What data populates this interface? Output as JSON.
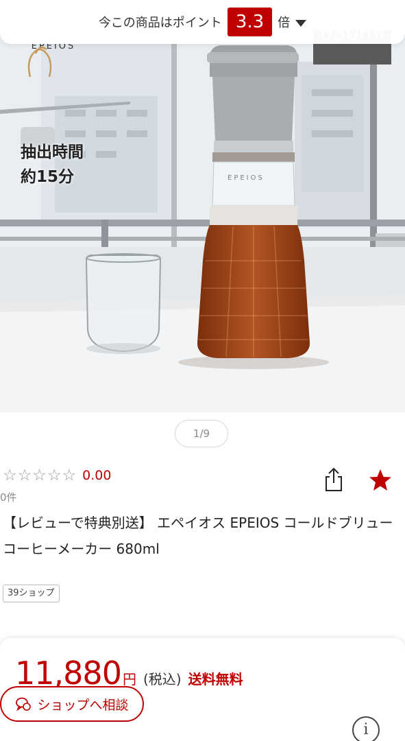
{
  "points_banner": {
    "prefix": "今この商品はポイント",
    "rate": "3.3",
    "unit": "倍",
    "caret_icon": "caret-down-icon"
  },
  "hero": {
    "brand": "EPEIOS",
    "brew_time_line1": "抽出時間",
    "brew_time_line2": "約15分",
    "capacity": "680ml",
    "bottle_label": "EPEIOS"
  },
  "pager": {
    "label": "1/9"
  },
  "rating": {
    "stars": 0,
    "max_stars": 5,
    "score": "0.00",
    "count": "0件"
  },
  "actions": {
    "share_icon": "share-icon",
    "favorite_icon": "star-icon"
  },
  "product": {
    "title": "【レビューで特典別送】 エペイオス EPEIOS コールドブリューコーヒーメーカー 680ml",
    "shop_tag": "39ショップ"
  },
  "price": {
    "amount": "11,880",
    "yen": "円",
    "tax": "(税込)",
    "shipping": "送料無料"
  },
  "consult": {
    "label": "ショップへ相談",
    "icon": "chat-icon"
  },
  "info": {
    "label": "i"
  },
  "colors": {
    "accent": "#bf0000",
    "text": "#222222",
    "muted": "#8a8a8a"
  }
}
